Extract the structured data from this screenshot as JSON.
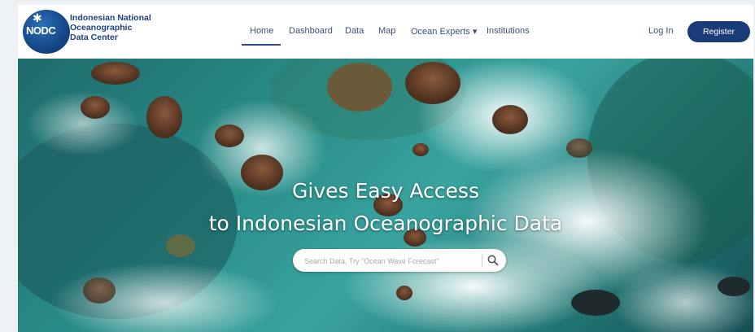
{
  "logo": {
    "badge_text": "NODC",
    "line1": "Indonesian National",
    "line2": "Oceanographic",
    "line3": "Data Center"
  },
  "nav": {
    "items": [
      {
        "label": "Home",
        "active": true
      },
      {
        "label": "Dashboard"
      },
      {
        "label": "Data"
      },
      {
        "label": "Map"
      },
      {
        "label": "Ocean Experts ▾"
      },
      {
        "label": "Institutions"
      }
    ]
  },
  "auth": {
    "login_label": "Log In",
    "register_label": "Register"
  },
  "hero": {
    "title_line1": "Gives Easy Access",
    "title_line2": "to Indonesian Oceanographic Data"
  },
  "search": {
    "placeholder": "Search Data, Try \"Ocean Wave Forecast\"",
    "value": ""
  },
  "colors": {
    "brand": "#1b3b78",
    "nav_text": "#3a4f7a"
  }
}
